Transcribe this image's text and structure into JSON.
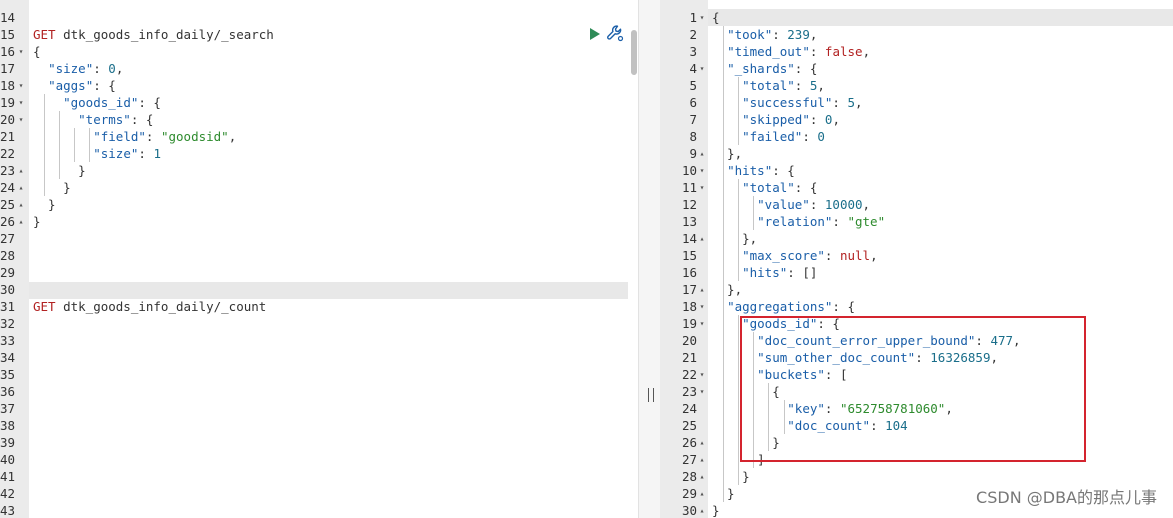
{
  "watermark": "CSDN @DBA的那点儿事",
  "colors": {
    "method": "#b22222",
    "key": "#1a5ea8",
    "string": "#2e8b2e",
    "number": "#1a6e8a",
    "highlight_box": "#d4242e",
    "run_icon": "#2e8b57",
    "wrench_icon": "#1a5ea8"
  },
  "icons": {
    "run": "play-icon",
    "settings": "wrench-icon"
  },
  "left_editor": {
    "lines": [
      {
        "n": "14",
        "fold": "",
        "tokens": []
      },
      {
        "n": "15",
        "fold": "",
        "tokens": [
          {
            "t": "m",
            "v": "GET"
          },
          {
            "t": "u",
            "v": " dtk_goods_info_daily/_search"
          }
        ]
      },
      {
        "n": "16",
        "fold": "▾",
        "tokens": [
          {
            "t": "p",
            "v": "{"
          }
        ]
      },
      {
        "n": "17",
        "fold": "",
        "tokens": [
          {
            "t": "p",
            "v": "  "
          },
          {
            "t": "k",
            "v": "\"size\""
          },
          {
            "t": "p",
            "v": ": "
          },
          {
            "t": "n",
            "v": "0"
          },
          {
            "t": "p",
            "v": ","
          }
        ]
      },
      {
        "n": "18",
        "fold": "▾",
        "tokens": [
          {
            "t": "p",
            "v": "  "
          },
          {
            "t": "k",
            "v": "\"aggs\""
          },
          {
            "t": "p",
            "v": ": {"
          }
        ]
      },
      {
        "n": "19",
        "fold": "▾",
        "tokens": [
          {
            "t": "p",
            "v": "    "
          },
          {
            "t": "k",
            "v": "\"goods_id\""
          },
          {
            "t": "p",
            "v": ": {"
          }
        ]
      },
      {
        "n": "20",
        "fold": "▾",
        "tokens": [
          {
            "t": "p",
            "v": "      "
          },
          {
            "t": "k",
            "v": "\"terms\""
          },
          {
            "t": "p",
            "v": ": {"
          }
        ]
      },
      {
        "n": "21",
        "fold": "",
        "tokens": [
          {
            "t": "p",
            "v": "        "
          },
          {
            "t": "k",
            "v": "\"field\""
          },
          {
            "t": "p",
            "v": ": "
          },
          {
            "t": "s",
            "v": "\"goodsid\""
          },
          {
            "t": "p",
            "v": ","
          }
        ]
      },
      {
        "n": "22",
        "fold": "",
        "tokens": [
          {
            "t": "p",
            "v": "        "
          },
          {
            "t": "k",
            "v": "\"size\""
          },
          {
            "t": "p",
            "v": ": "
          },
          {
            "t": "n",
            "v": "1"
          }
        ]
      },
      {
        "n": "23",
        "fold": "▴",
        "tokens": [
          {
            "t": "p",
            "v": "      }"
          }
        ]
      },
      {
        "n": "24",
        "fold": "▴",
        "tokens": [
          {
            "t": "p",
            "v": "    }"
          }
        ]
      },
      {
        "n": "25",
        "fold": "▴",
        "tokens": [
          {
            "t": "p",
            "v": "  }"
          }
        ]
      },
      {
        "n": "26",
        "fold": "▴",
        "tokens": [
          {
            "t": "p",
            "v": "}"
          }
        ]
      },
      {
        "n": "27",
        "fold": "",
        "tokens": []
      },
      {
        "n": "28",
        "fold": "",
        "tokens": []
      },
      {
        "n": "29",
        "fold": "",
        "tokens": []
      },
      {
        "n": "30",
        "fold": "",
        "tokens": []
      },
      {
        "n": "31",
        "fold": "",
        "tokens": [
          {
            "t": "m",
            "v": "GET"
          },
          {
            "t": "u",
            "v": " dtk_goods_info_daily/_count"
          }
        ]
      },
      {
        "n": "32",
        "fold": "",
        "tokens": []
      },
      {
        "n": "33",
        "fold": "",
        "tokens": []
      },
      {
        "n": "34",
        "fold": "",
        "tokens": []
      },
      {
        "n": "35",
        "fold": "",
        "tokens": []
      },
      {
        "n": "36",
        "fold": "",
        "tokens": []
      },
      {
        "n": "37",
        "fold": "",
        "tokens": []
      },
      {
        "n": "38",
        "fold": "",
        "tokens": []
      },
      {
        "n": "39",
        "fold": "",
        "tokens": []
      },
      {
        "n": "40",
        "fold": "",
        "tokens": []
      },
      {
        "n": "41",
        "fold": "",
        "tokens": []
      },
      {
        "n": "42",
        "fold": "",
        "tokens": []
      },
      {
        "n": "43",
        "fold": "",
        "tokens": []
      }
    ]
  },
  "right_editor": {
    "lines": [
      {
        "n": "1",
        "fold": "▾",
        "tokens": [
          {
            "t": "p",
            "v": "{"
          }
        ]
      },
      {
        "n": "2",
        "fold": "",
        "tokens": [
          {
            "t": "p",
            "v": "  "
          },
          {
            "t": "k",
            "v": "\"took\""
          },
          {
            "t": "p",
            "v": ": "
          },
          {
            "t": "n",
            "v": "239"
          },
          {
            "t": "p",
            "v": ","
          }
        ]
      },
      {
        "n": "3",
        "fold": "",
        "tokens": [
          {
            "t": "p",
            "v": "  "
          },
          {
            "t": "k",
            "v": "\"timed_out\""
          },
          {
            "t": "p",
            "v": ": "
          },
          {
            "t": "b",
            "v": "false"
          },
          {
            "t": "p",
            "v": ","
          }
        ]
      },
      {
        "n": "4",
        "fold": "▾",
        "tokens": [
          {
            "t": "p",
            "v": "  "
          },
          {
            "t": "k",
            "v": "\"_shards\""
          },
          {
            "t": "p",
            "v": ": {"
          }
        ]
      },
      {
        "n": "5",
        "fold": "",
        "tokens": [
          {
            "t": "p",
            "v": "    "
          },
          {
            "t": "k",
            "v": "\"total\""
          },
          {
            "t": "p",
            "v": ": "
          },
          {
            "t": "n",
            "v": "5"
          },
          {
            "t": "p",
            "v": ","
          }
        ]
      },
      {
        "n": "6",
        "fold": "",
        "tokens": [
          {
            "t": "p",
            "v": "    "
          },
          {
            "t": "k",
            "v": "\"successful\""
          },
          {
            "t": "p",
            "v": ": "
          },
          {
            "t": "n",
            "v": "5"
          },
          {
            "t": "p",
            "v": ","
          }
        ]
      },
      {
        "n": "7",
        "fold": "",
        "tokens": [
          {
            "t": "p",
            "v": "    "
          },
          {
            "t": "k",
            "v": "\"skipped\""
          },
          {
            "t": "p",
            "v": ": "
          },
          {
            "t": "n",
            "v": "0"
          },
          {
            "t": "p",
            "v": ","
          }
        ]
      },
      {
        "n": "8",
        "fold": "",
        "tokens": [
          {
            "t": "p",
            "v": "    "
          },
          {
            "t": "k",
            "v": "\"failed\""
          },
          {
            "t": "p",
            "v": ": "
          },
          {
            "t": "n",
            "v": "0"
          }
        ]
      },
      {
        "n": "9",
        "fold": "▴",
        "tokens": [
          {
            "t": "p",
            "v": "  },"
          }
        ]
      },
      {
        "n": "10",
        "fold": "▾",
        "tokens": [
          {
            "t": "p",
            "v": "  "
          },
          {
            "t": "k",
            "v": "\"hits\""
          },
          {
            "t": "p",
            "v": ": {"
          }
        ]
      },
      {
        "n": "11",
        "fold": "▾",
        "tokens": [
          {
            "t": "p",
            "v": "    "
          },
          {
            "t": "k",
            "v": "\"total\""
          },
          {
            "t": "p",
            "v": ": {"
          }
        ]
      },
      {
        "n": "12",
        "fold": "",
        "tokens": [
          {
            "t": "p",
            "v": "      "
          },
          {
            "t": "k",
            "v": "\"value\""
          },
          {
            "t": "p",
            "v": ": "
          },
          {
            "t": "n",
            "v": "10000"
          },
          {
            "t": "p",
            "v": ","
          }
        ]
      },
      {
        "n": "13",
        "fold": "",
        "tokens": [
          {
            "t": "p",
            "v": "      "
          },
          {
            "t": "k",
            "v": "\"relation\""
          },
          {
            "t": "p",
            "v": ": "
          },
          {
            "t": "s",
            "v": "\"gte\""
          }
        ]
      },
      {
        "n": "14",
        "fold": "▴",
        "tokens": [
          {
            "t": "p",
            "v": "    },"
          }
        ]
      },
      {
        "n": "15",
        "fold": "",
        "tokens": [
          {
            "t": "p",
            "v": "    "
          },
          {
            "t": "k",
            "v": "\"max_score\""
          },
          {
            "t": "p",
            "v": ": "
          },
          {
            "t": "b",
            "v": "null"
          },
          {
            "t": "p",
            "v": ","
          }
        ]
      },
      {
        "n": "16",
        "fold": "",
        "tokens": [
          {
            "t": "p",
            "v": "    "
          },
          {
            "t": "k",
            "v": "\"hits\""
          },
          {
            "t": "p",
            "v": ": []"
          }
        ]
      },
      {
        "n": "17",
        "fold": "▴",
        "tokens": [
          {
            "t": "p",
            "v": "  },"
          }
        ]
      },
      {
        "n": "18",
        "fold": "▾",
        "tokens": [
          {
            "t": "p",
            "v": "  "
          },
          {
            "t": "k",
            "v": "\"aggregations\""
          },
          {
            "t": "p",
            "v": ": {"
          }
        ]
      },
      {
        "n": "19",
        "fold": "▾",
        "tokens": [
          {
            "t": "p",
            "v": "    "
          },
          {
            "t": "k",
            "v": "\"goods_id\""
          },
          {
            "t": "p",
            "v": ": {"
          }
        ]
      },
      {
        "n": "20",
        "fold": "",
        "tokens": [
          {
            "t": "p",
            "v": "      "
          },
          {
            "t": "k",
            "v": "\"doc_count_error_upper_bound\""
          },
          {
            "t": "p",
            "v": ": "
          },
          {
            "t": "n",
            "v": "477"
          },
          {
            "t": "p",
            "v": ","
          }
        ]
      },
      {
        "n": "21",
        "fold": "",
        "tokens": [
          {
            "t": "p",
            "v": "      "
          },
          {
            "t": "k",
            "v": "\"sum_other_doc_count\""
          },
          {
            "t": "p",
            "v": ": "
          },
          {
            "t": "n",
            "v": "16326859"
          },
          {
            "t": "p",
            "v": ","
          }
        ]
      },
      {
        "n": "22",
        "fold": "▾",
        "tokens": [
          {
            "t": "p",
            "v": "      "
          },
          {
            "t": "k",
            "v": "\"buckets\""
          },
          {
            "t": "p",
            "v": ": ["
          }
        ]
      },
      {
        "n": "23",
        "fold": "▾",
        "tokens": [
          {
            "t": "p",
            "v": "        {"
          }
        ]
      },
      {
        "n": "24",
        "fold": "",
        "tokens": [
          {
            "t": "p",
            "v": "          "
          },
          {
            "t": "k",
            "v": "\"key\""
          },
          {
            "t": "p",
            "v": ": "
          },
          {
            "t": "s",
            "v": "\"652758781060\""
          },
          {
            "t": "p",
            "v": ","
          }
        ]
      },
      {
        "n": "25",
        "fold": "",
        "tokens": [
          {
            "t": "p",
            "v": "          "
          },
          {
            "t": "k",
            "v": "\"doc_count\""
          },
          {
            "t": "p",
            "v": ": "
          },
          {
            "t": "n",
            "v": "104"
          }
        ]
      },
      {
        "n": "26",
        "fold": "▴",
        "tokens": [
          {
            "t": "p",
            "v": "        }"
          }
        ]
      },
      {
        "n": "27",
        "fold": "▴",
        "tokens": [
          {
            "t": "p",
            "v": "      ]"
          }
        ]
      },
      {
        "n": "28",
        "fold": "▴",
        "tokens": [
          {
            "t": "p",
            "v": "    }"
          }
        ]
      },
      {
        "n": "29",
        "fold": "▴",
        "tokens": [
          {
            "t": "p",
            "v": "  }"
          }
        ]
      },
      {
        "n": "30",
        "fold": "▴",
        "tokens": [
          {
            "t": "p",
            "v": "}"
          }
        ]
      }
    ]
  }
}
